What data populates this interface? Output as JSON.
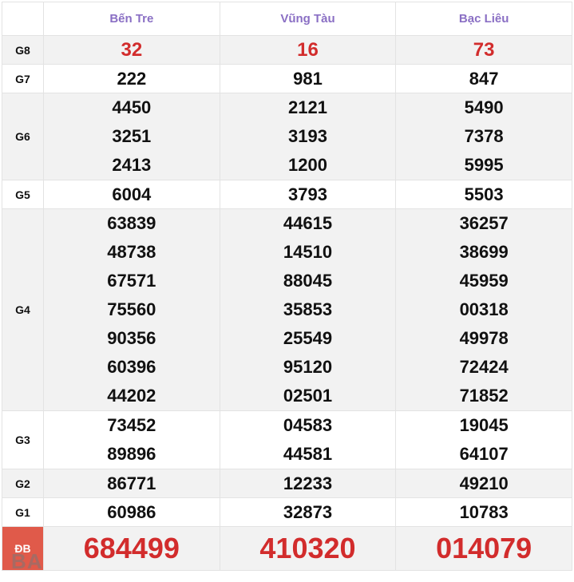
{
  "provinces": [
    "Bến Tre",
    "Vũng Tàu",
    "Bạc Liêu"
  ],
  "rows": [
    {
      "prize": "G8",
      "style": "red",
      "bg": "alt",
      "values": [
        [
          "32"
        ],
        [
          "16"
        ],
        [
          "73"
        ]
      ]
    },
    {
      "prize": "G7",
      "style": "normal",
      "bg": "white",
      "values": [
        [
          "222"
        ],
        [
          "981"
        ],
        [
          "847"
        ]
      ]
    },
    {
      "prize": "G6",
      "style": "normal",
      "bg": "alt",
      "values": [
        [
          "4450",
          "3251",
          "2413"
        ],
        [
          "2121",
          "3193",
          "1200"
        ],
        [
          "5490",
          "7378",
          "5995"
        ]
      ]
    },
    {
      "prize": "G5",
      "style": "normal",
      "bg": "white",
      "values": [
        [
          "6004"
        ],
        [
          "3793"
        ],
        [
          "5503"
        ]
      ]
    },
    {
      "prize": "G4",
      "style": "normal",
      "bg": "alt",
      "values": [
        [
          "63839",
          "48738",
          "67571",
          "75560",
          "90356",
          "60396",
          "44202"
        ],
        [
          "44615",
          "14510",
          "88045",
          "35853",
          "25549",
          "95120",
          "02501"
        ],
        [
          "36257",
          "38699",
          "45959",
          "00318",
          "49978",
          "72424",
          "71852"
        ]
      ]
    },
    {
      "prize": "G3",
      "style": "normal",
      "bg": "white",
      "values": [
        [
          "73452",
          "89896"
        ],
        [
          "04583",
          "44581"
        ],
        [
          "19045",
          "64107"
        ]
      ]
    },
    {
      "prize": "G2",
      "style": "normal",
      "bg": "alt",
      "values": [
        [
          "86771"
        ],
        [
          "12233"
        ],
        [
          "49210"
        ]
      ]
    },
    {
      "prize": "G1",
      "style": "normal",
      "bg": "white",
      "values": [
        [
          "60986"
        ],
        [
          "32873"
        ],
        [
          "10783"
        ]
      ]
    },
    {
      "prize": "ĐB",
      "style": "special",
      "bg": "alt",
      "values": [
        [
          "684499"
        ],
        [
          "410320"
        ],
        [
          "014079"
        ]
      ]
    }
  ],
  "watermark": "BA"
}
